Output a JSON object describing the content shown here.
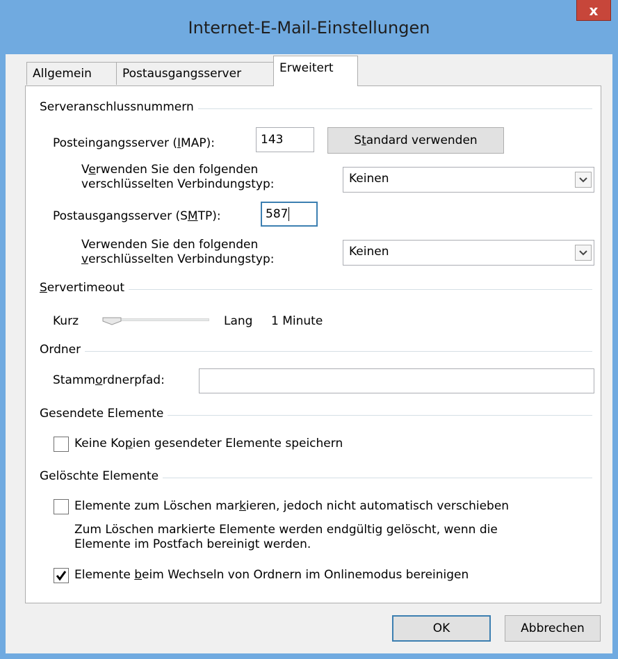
{
  "window": {
    "title": "Internet-E-Mail-Einstellungen",
    "close_label": "x"
  },
  "tabs": [
    {
      "label": "Allgemein"
    },
    {
      "label": "Postausgangsserver"
    },
    {
      "label": "Erweitert"
    }
  ],
  "ports": {
    "group_title": "Serveranschlussnummern",
    "imap_label_pre": "Posteingangsserver (",
    "imap_label_key": "I",
    "imap_label_post": "MAP):",
    "imap_value": "143",
    "default_button": {
      "pre": "S",
      "key": "t",
      "post": "andard verwenden"
    },
    "enc1_label_pre": "V",
    "enc1_label_key": "e",
    "enc1_label_post": "rwenden Sie den folgenden",
    "enc1_label_line2": "verschlüsselten Verbindungstyp:",
    "enc1_value": "Keinen",
    "smtp_label_pre": "Postausgangsserver (S",
    "smtp_label_key": "M",
    "smtp_label_post": "TP):",
    "smtp_value": "587",
    "enc2_label_line1": "Verwenden Sie den folgenden",
    "enc2_label_key": "v",
    "enc2_label_post": "erschlüsselten Verbindungstyp:",
    "enc2_value": "Keinen"
  },
  "timeout": {
    "group_title_key": "S",
    "group_title_post": "ervertimeout",
    "short_label": "Kurz",
    "long_label": "Lang",
    "value_text": "1 Minute",
    "slider_level": 0.0
  },
  "folders": {
    "group_title": "Ordner",
    "root_label_pre": "Stamm",
    "root_label_key": "o",
    "root_label_post": "rdnerpfad:",
    "root_value": ""
  },
  "sent": {
    "group_title": "Gesendete Elemente",
    "checkbox_pre": "Keine Ko",
    "checkbox_key": "p",
    "checkbox_post": "ien gesendeter Elemente speichern",
    "checked": false
  },
  "deleted": {
    "group_title": "Gelöschte Elemente",
    "mark_pre": "Elemente zum Löschen mar",
    "mark_key": "k",
    "mark_post": "ieren, jedoch nicht automatisch verschieben",
    "mark_checked": false,
    "info_line1": "Zum Löschen markierte Elemente werden endgültig gelöscht, wenn die",
    "info_line2": "Elemente im Postfach bereinigt werden.",
    "purge_pre": "Elemente ",
    "purge_key": "b",
    "purge_post": "eim Wechseln von Ordnern im Onlinemodus bereinigen",
    "purge_checked": true
  },
  "footer": {
    "ok_label": "OK",
    "cancel_label": "Abbrechen"
  },
  "colors": {
    "frame": "#70aae0",
    "close": "#c7463a",
    "focus": "#3c7fb1"
  }
}
